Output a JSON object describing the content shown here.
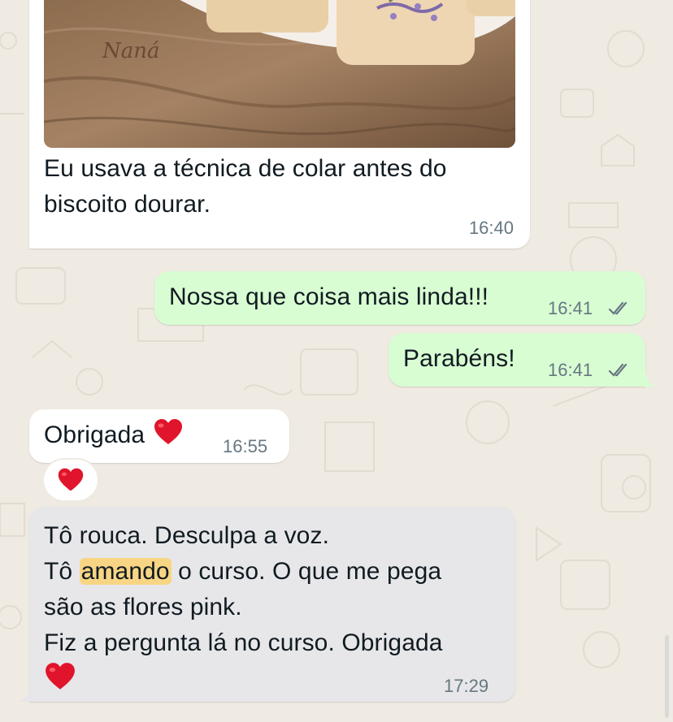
{
  "messages": [
    {
      "id": "img-msg",
      "direction": "incoming",
      "type": "image",
      "image_watermark": "Naná",
      "caption": "Eu usava a técnica de colar antes do biscoito dourar.",
      "time": "16:40"
    },
    {
      "id": "out1",
      "direction": "outgoing",
      "text": "Nossa que coisa mais linda!!!",
      "time": "16:41",
      "status_icon": "double-check-icon"
    },
    {
      "id": "out2",
      "direction": "outgoing",
      "text": "Parabéns!",
      "time": "16:41",
      "status_icon": "double-check-icon"
    },
    {
      "id": "in2",
      "direction": "incoming",
      "text": "Obrigada",
      "emoji": "red-heart-icon",
      "time": "16:55",
      "reaction": "red-heart-icon"
    },
    {
      "id": "in3",
      "direction": "incoming",
      "selected": true,
      "lines": {
        "line1": "Tô rouca. Desculpa a voz.",
        "line2_pre": "Tô ",
        "line2_highlight": "amando",
        "line2_post": " o curso. O que me pega",
        "line3": "são as flores pink.",
        "line4": "Fiz a pergunta lá no curso. Obrigada"
      },
      "emoji": "red-heart-icon",
      "time": "17:29"
    }
  ],
  "colors": {
    "chat_background": "#efeae2",
    "incoming_bubble": "#ffffff",
    "outgoing_bubble": "#d9fdd3",
    "selected_bubble": "#e7e7e9",
    "search_highlight": "#f8d584",
    "timestamp": "#667781",
    "heart": "#e0142b"
  }
}
